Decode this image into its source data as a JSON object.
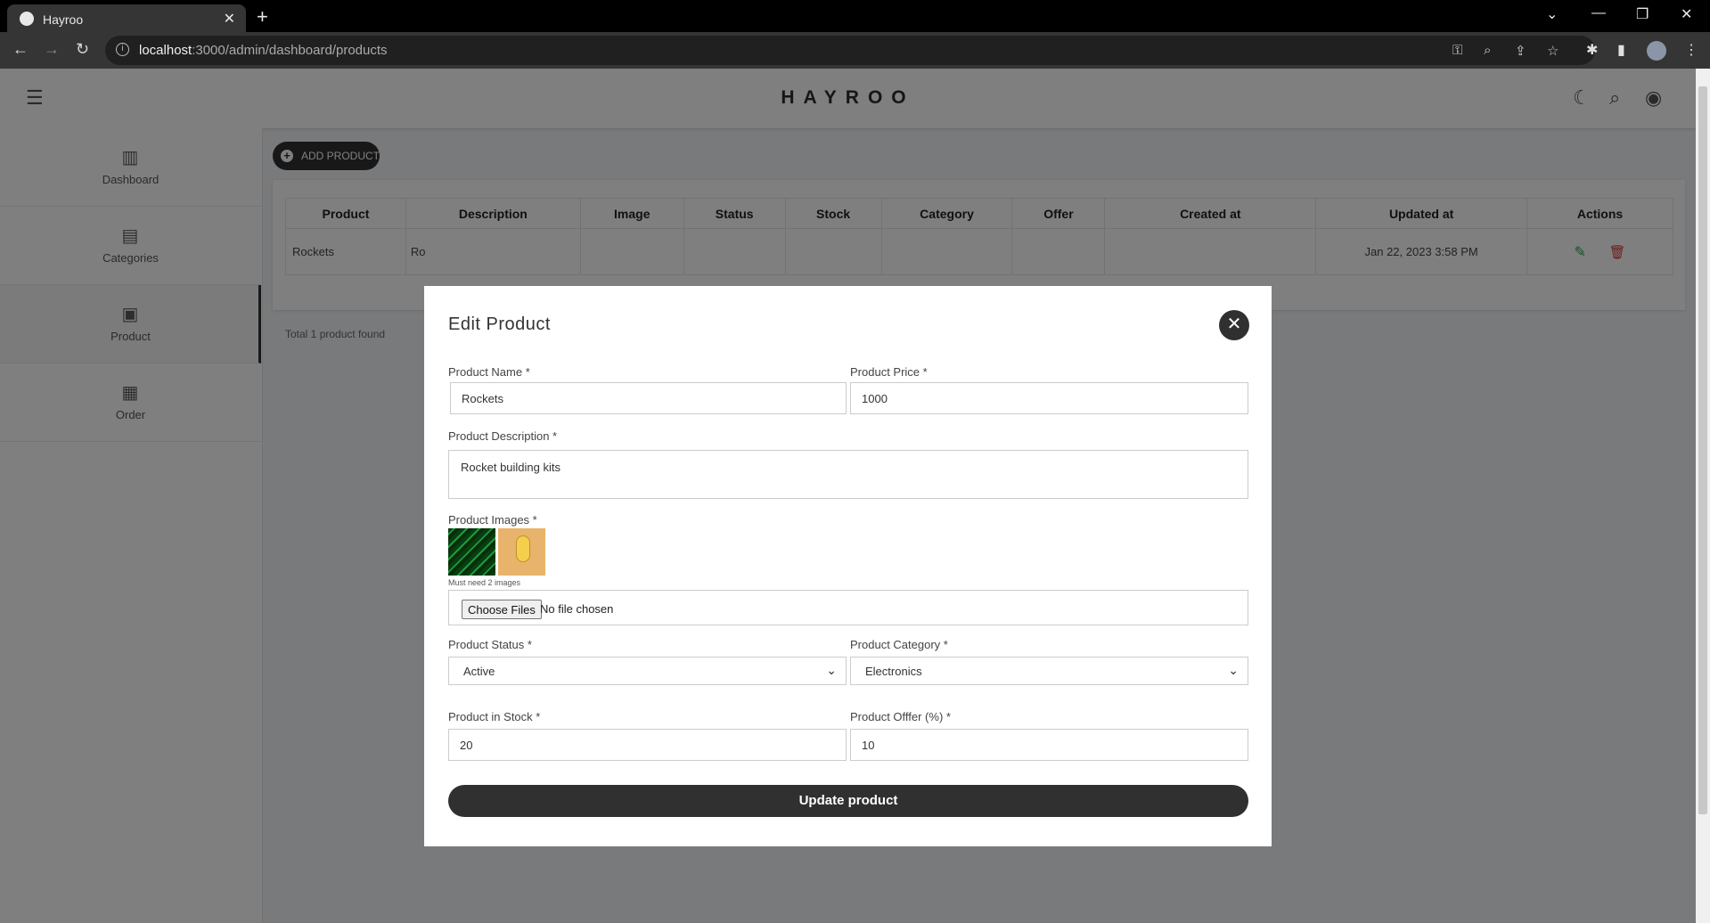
{
  "browser": {
    "tab_title": "Hayroo",
    "url_host": "localhost",
    "url_path": ":3000/admin/dashboard/products"
  },
  "header": {
    "brand": "HAYROO"
  },
  "sidebar": {
    "items": [
      {
        "label": "Dashboard",
        "icon": "chart-icon"
      },
      {
        "label": "Categories",
        "icon": "table-icon"
      },
      {
        "label": "Product",
        "icon": "archive-icon"
      },
      {
        "label": "Order",
        "icon": "clipboard-icon"
      }
    ]
  },
  "toolbar": {
    "add_label": "ADD PRODUCT"
  },
  "table": {
    "headers": [
      "Product",
      "Description",
      "Image",
      "Status",
      "Stock",
      "Category",
      "Offer",
      "Created at",
      "Updated at",
      "Actions"
    ],
    "rows": [
      {
        "product": "Rockets",
        "description": "Ro",
        "updated": "Jan 22, 2023 3:58 PM"
      }
    ],
    "total": "Total 1 product found"
  },
  "modal": {
    "title": "Edit Product",
    "name_label": "Product Name *",
    "name_value": "Rockets",
    "price_label": "Product Price *",
    "price_value": "1000",
    "desc_label": "Product Description *",
    "desc_value": "Rocket building kits",
    "images_label": "Product Images *",
    "images_note": "Must need 2 images",
    "choose_files": "Choose Files",
    "no_file": "No file chosen",
    "status_label": "Product Status *",
    "status_value": "Active",
    "category_label": "Product Category *",
    "category_value": "Electronics",
    "stock_label": "Product in Stock *",
    "stock_value": "20",
    "offer_label": "Product Offfer (%) *",
    "offer_value": "10",
    "submit_label": "Update product"
  },
  "colors": {
    "accent": "#303031",
    "edit": "#2e9e4f",
    "delete": "#d93838"
  }
}
